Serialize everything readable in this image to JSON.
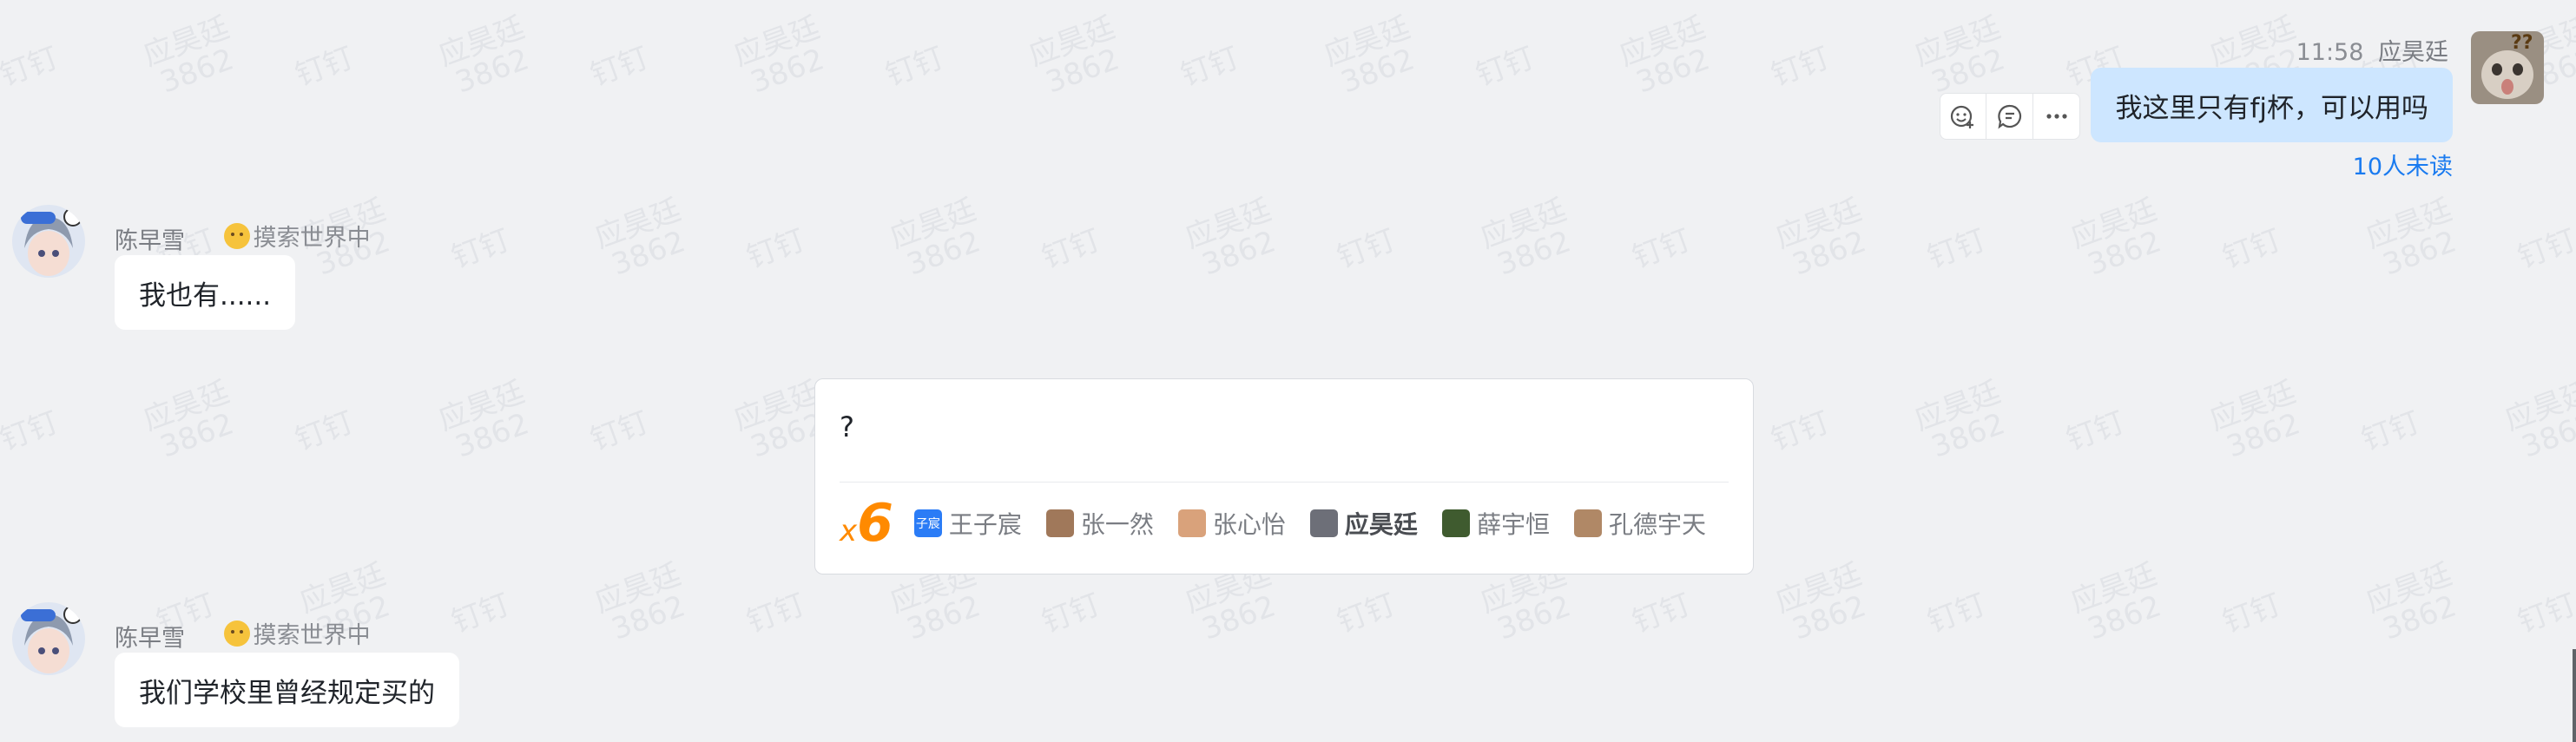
{
  "watermark": {
    "brand": "钉钉",
    "name": "应昊廷",
    "code": "3862"
  },
  "self_message": {
    "time": "11:58",
    "sender": "应昊廷",
    "text": "我这里只有fj杯，可以用吗",
    "read_status": "10人未读",
    "actions": [
      {
        "icon": "add-reaction-icon"
      },
      {
        "icon": "comment-icon"
      },
      {
        "icon": "more-icon"
      }
    ]
  },
  "messages": [
    {
      "sender": "陈早雪",
      "status": "摸索世界中",
      "text": "我也有......"
    },
    {
      "sender": "陈早雪",
      "status": "摸索世界中",
      "text": "我们学校里曾经规定买的"
    }
  ],
  "ding_card": {
    "text": "?",
    "count_prefix": "x",
    "count": "6",
    "recipients": [
      {
        "name": "王子宸",
        "badge": "子宸",
        "color": "#2b7cf6",
        "highlight": false
      },
      {
        "name": "张一然",
        "badge": "",
        "color": "#a0785a",
        "highlight": false
      },
      {
        "name": "张心怡",
        "badge": "",
        "color": "#d9a27b",
        "highlight": false
      },
      {
        "name": "应昊廷",
        "badge": "",
        "color": "#6d6f78",
        "highlight": true
      },
      {
        "name": "薛宇恒",
        "badge": "",
        "color": "#3f5b2f",
        "highlight": false
      },
      {
        "name": "孔德宇天",
        "badge": "",
        "color": "#b08866",
        "highlight": false
      }
    ]
  }
}
